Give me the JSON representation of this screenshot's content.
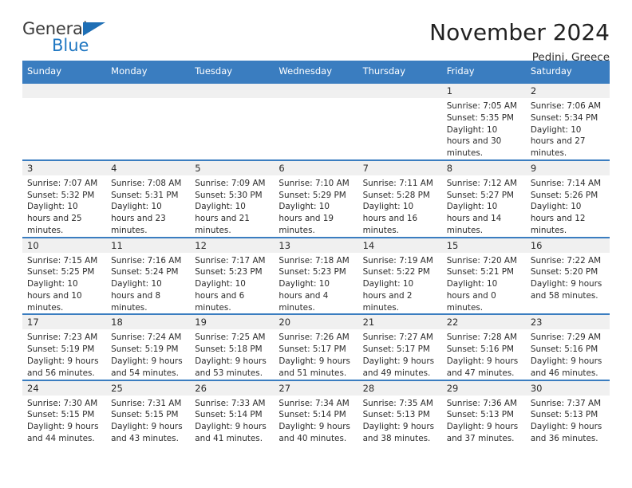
{
  "brand": {
    "name_part1": "General",
    "name_part2": "Blue",
    "triangle_color": "#1f6fb5",
    "blue_color": "#1f77c2"
  },
  "header": {
    "title": "November 2024",
    "subtitle": "Pedini, Greece"
  },
  "theme": {
    "header_blue": "#3a7dc0",
    "daynum_band": "#f0f0f0",
    "text": "#2b2b2b"
  },
  "calendar": {
    "weekday_headers": [
      "Sunday",
      "Monday",
      "Tuesday",
      "Wednesday",
      "Thursday",
      "Friday",
      "Saturday"
    ],
    "labels": {
      "sunrise": "Sunrise:",
      "sunset": "Sunset:",
      "daylight": "Daylight:"
    },
    "weeks": [
      [
        {
          "day": "",
          "empty": true
        },
        {
          "day": "",
          "empty": true
        },
        {
          "day": "",
          "empty": true
        },
        {
          "day": "",
          "empty": true
        },
        {
          "day": "",
          "empty": true
        },
        {
          "day": "1",
          "sunrise": "Sunrise: 7:05 AM",
          "sunset": "Sunset: 5:35 PM",
          "daylight": "Daylight: 10 hours and 30 minutes."
        },
        {
          "day": "2",
          "sunrise": "Sunrise: 7:06 AM",
          "sunset": "Sunset: 5:34 PM",
          "daylight": "Daylight: 10 hours and 27 minutes."
        }
      ],
      [
        {
          "day": "3",
          "sunrise": "Sunrise: 7:07 AM",
          "sunset": "Sunset: 5:32 PM",
          "daylight": "Daylight: 10 hours and 25 minutes."
        },
        {
          "day": "4",
          "sunrise": "Sunrise: 7:08 AM",
          "sunset": "Sunset: 5:31 PM",
          "daylight": "Daylight: 10 hours and 23 minutes."
        },
        {
          "day": "5",
          "sunrise": "Sunrise: 7:09 AM",
          "sunset": "Sunset: 5:30 PM",
          "daylight": "Daylight: 10 hours and 21 minutes."
        },
        {
          "day": "6",
          "sunrise": "Sunrise: 7:10 AM",
          "sunset": "Sunset: 5:29 PM",
          "daylight": "Daylight: 10 hours and 19 minutes."
        },
        {
          "day": "7",
          "sunrise": "Sunrise: 7:11 AM",
          "sunset": "Sunset: 5:28 PM",
          "daylight": "Daylight: 10 hours and 16 minutes."
        },
        {
          "day": "8",
          "sunrise": "Sunrise: 7:12 AM",
          "sunset": "Sunset: 5:27 PM",
          "daylight": "Daylight: 10 hours and 14 minutes."
        },
        {
          "day": "9",
          "sunrise": "Sunrise: 7:14 AM",
          "sunset": "Sunset: 5:26 PM",
          "daylight": "Daylight: 10 hours and 12 minutes."
        }
      ],
      [
        {
          "day": "10",
          "sunrise": "Sunrise: 7:15 AM",
          "sunset": "Sunset: 5:25 PM",
          "daylight": "Daylight: 10 hours and 10 minutes."
        },
        {
          "day": "11",
          "sunrise": "Sunrise: 7:16 AM",
          "sunset": "Sunset: 5:24 PM",
          "daylight": "Daylight: 10 hours and 8 minutes."
        },
        {
          "day": "12",
          "sunrise": "Sunrise: 7:17 AM",
          "sunset": "Sunset: 5:23 PM",
          "daylight": "Daylight: 10 hours and 6 minutes."
        },
        {
          "day": "13",
          "sunrise": "Sunrise: 7:18 AM",
          "sunset": "Sunset: 5:23 PM",
          "daylight": "Daylight: 10 hours and 4 minutes."
        },
        {
          "day": "14",
          "sunrise": "Sunrise: 7:19 AM",
          "sunset": "Sunset: 5:22 PM",
          "daylight": "Daylight: 10 hours and 2 minutes."
        },
        {
          "day": "15",
          "sunrise": "Sunrise: 7:20 AM",
          "sunset": "Sunset: 5:21 PM",
          "daylight": "Daylight: 10 hours and 0 minutes."
        },
        {
          "day": "16",
          "sunrise": "Sunrise: 7:22 AM",
          "sunset": "Sunset: 5:20 PM",
          "daylight": "Daylight: 9 hours and 58 minutes."
        }
      ],
      [
        {
          "day": "17",
          "sunrise": "Sunrise: 7:23 AM",
          "sunset": "Sunset: 5:19 PM",
          "daylight": "Daylight: 9 hours and 56 minutes."
        },
        {
          "day": "18",
          "sunrise": "Sunrise: 7:24 AM",
          "sunset": "Sunset: 5:19 PM",
          "daylight": "Daylight: 9 hours and 54 minutes."
        },
        {
          "day": "19",
          "sunrise": "Sunrise: 7:25 AM",
          "sunset": "Sunset: 5:18 PM",
          "daylight": "Daylight: 9 hours and 53 minutes."
        },
        {
          "day": "20",
          "sunrise": "Sunrise: 7:26 AM",
          "sunset": "Sunset: 5:17 PM",
          "daylight": "Daylight: 9 hours and 51 minutes."
        },
        {
          "day": "21",
          "sunrise": "Sunrise: 7:27 AM",
          "sunset": "Sunset: 5:17 PM",
          "daylight": "Daylight: 9 hours and 49 minutes."
        },
        {
          "day": "22",
          "sunrise": "Sunrise: 7:28 AM",
          "sunset": "Sunset: 5:16 PM",
          "daylight": "Daylight: 9 hours and 47 minutes."
        },
        {
          "day": "23",
          "sunrise": "Sunrise: 7:29 AM",
          "sunset": "Sunset: 5:16 PM",
          "daylight": "Daylight: 9 hours and 46 minutes."
        }
      ],
      [
        {
          "day": "24",
          "sunrise": "Sunrise: 7:30 AM",
          "sunset": "Sunset: 5:15 PM",
          "daylight": "Daylight: 9 hours and 44 minutes."
        },
        {
          "day": "25",
          "sunrise": "Sunrise: 7:31 AM",
          "sunset": "Sunset: 5:15 PM",
          "daylight": "Daylight: 9 hours and 43 minutes."
        },
        {
          "day": "26",
          "sunrise": "Sunrise: 7:33 AM",
          "sunset": "Sunset: 5:14 PM",
          "daylight": "Daylight: 9 hours and 41 minutes."
        },
        {
          "day": "27",
          "sunrise": "Sunrise: 7:34 AM",
          "sunset": "Sunset: 5:14 PM",
          "daylight": "Daylight: 9 hours and 40 minutes."
        },
        {
          "day": "28",
          "sunrise": "Sunrise: 7:35 AM",
          "sunset": "Sunset: 5:13 PM",
          "daylight": "Daylight: 9 hours and 38 minutes."
        },
        {
          "day": "29",
          "sunrise": "Sunrise: 7:36 AM",
          "sunset": "Sunset: 5:13 PM",
          "daylight": "Daylight: 9 hours and 37 minutes."
        },
        {
          "day": "30",
          "sunrise": "Sunrise: 7:37 AM",
          "sunset": "Sunset: 5:13 PM",
          "daylight": "Daylight: 9 hours and 36 minutes."
        }
      ]
    ]
  }
}
